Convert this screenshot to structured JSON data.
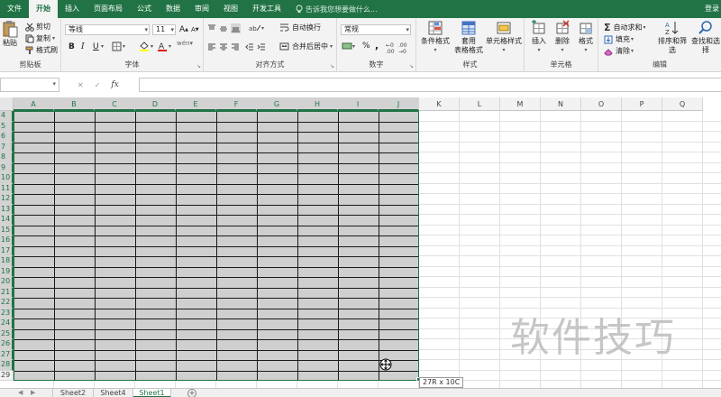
{
  "menu": {
    "tabs": [
      "文件",
      "开始",
      "插入",
      "页面布局",
      "公式",
      "数据",
      "审阅",
      "视图",
      "开发工具"
    ],
    "active_tab": "开始",
    "tellme": "告诉我您想要做什么...",
    "login": "登录"
  },
  "ribbon": {
    "clipboard": {
      "paste": "粘贴",
      "cut": "剪切",
      "copy": "复制",
      "format_painter": "格式刷",
      "label": "剪贴板"
    },
    "font": {
      "name": "等线",
      "size": "11",
      "label": "字体",
      "bold": "B",
      "italic": "I",
      "underline": "U",
      "grow": "A",
      "shrink": "A"
    },
    "alignment": {
      "wrap": "自动换行",
      "merge": "合并后居中",
      "label": "对齐方式"
    },
    "number": {
      "format": "常规",
      "percent": "%",
      "comma": ",",
      "label": "数字"
    },
    "styles": {
      "conditional": "条件格式",
      "table_line1": "套用",
      "table_line2": "表格格式",
      "cell_styles": "单元格样式",
      "label": "样式"
    },
    "cells": {
      "insert": "插入",
      "delete": "删除",
      "format": "格式",
      "label": "单元格"
    },
    "editing": {
      "autosum": "自动求和",
      "fill": "填充",
      "clear": "清除",
      "sort_filter": "排序和筛选",
      "find_select": "查找和选择",
      "label": "编辑"
    }
  },
  "formula_bar": {
    "fx": "fx",
    "value": ""
  },
  "grid": {
    "columns": [
      "A",
      "B",
      "C",
      "D",
      "E",
      "F",
      "G",
      "H",
      "I",
      "J",
      "K",
      "L",
      "M",
      "N",
      "O",
      "P",
      "Q"
    ],
    "rows": [
      "4",
      "5",
      "6",
      "7",
      "8",
      "9",
      "10",
      "11",
      "12",
      "13",
      "14",
      "15",
      "16",
      "17",
      "18",
      "19",
      "20",
      "21",
      "22",
      "23",
      "24",
      "25",
      "26",
      "27",
      "28",
      "29"
    ],
    "selection_tip": "27R x 10C",
    "watermark": "软件技巧"
  },
  "sheets": {
    "tabs": [
      "Sheet2",
      "Sheet4",
      "Sheet1"
    ],
    "active": "Sheet1",
    "add": "+"
  },
  "colors": {
    "accent": "#217346",
    "selection_fill": "#cfcfcf"
  }
}
